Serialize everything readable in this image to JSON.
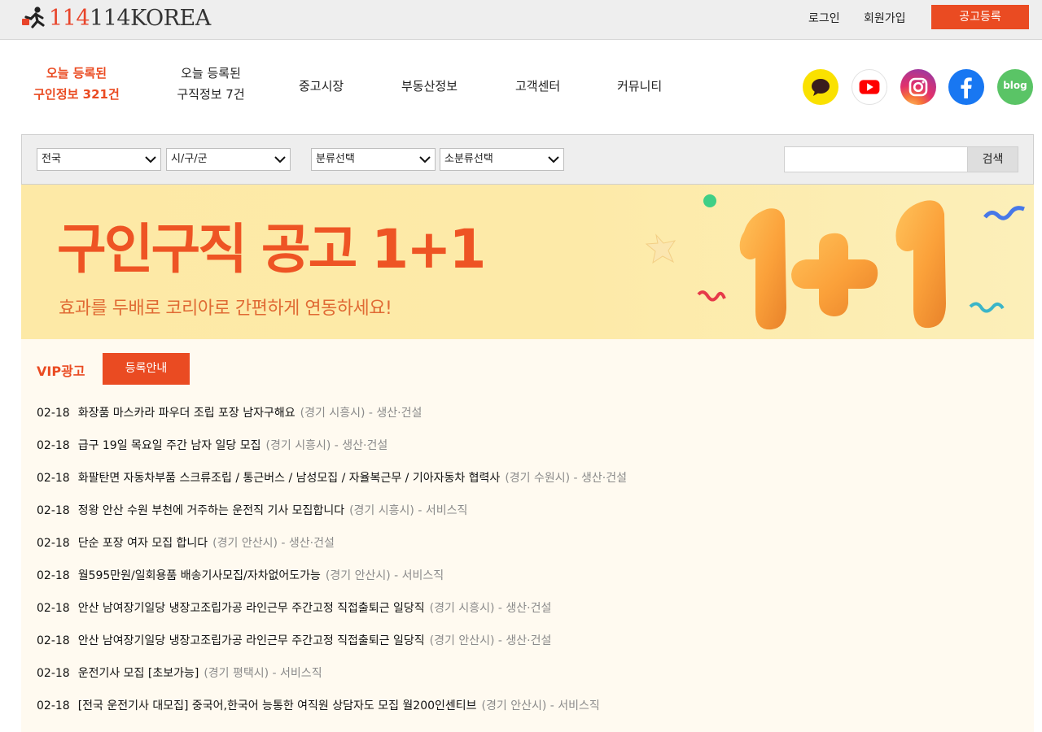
{
  "header": {
    "logo_prefix": "114",
    "logo_suffix": "114KOREA",
    "login": "로그인",
    "signup": "회원가입",
    "post_ad": "공고등록"
  },
  "nav": {
    "hiring_line1": "오늘 등록된",
    "hiring_line2": "구인정보 321건",
    "seeking_line1": "오늘 등록된",
    "seeking_line2": "구직정보 7건",
    "items": [
      "중고시장",
      "부동산정보",
      "고객센터",
      "커뮤니티"
    ]
  },
  "social": {
    "blog_label": "blog",
    "colors": {
      "kakao": "#fae100",
      "youtube": "#ff0000",
      "instagram": "#c13584",
      "facebook": "#1877f2",
      "blog": "#5ac466"
    }
  },
  "search": {
    "region": "전국",
    "district": "시/구/군",
    "category": "분류선택",
    "subcategory": "소분류선택",
    "query": "",
    "button": "검색"
  },
  "banner": {
    "title": "구인구직 공고 1+1",
    "subtitle": "효과를 두배로 코리아로 간편하게 연동하세요!"
  },
  "vip": {
    "label": "VIP광고",
    "button": "등록안내"
  },
  "jobs": [
    {
      "date": "02-18",
      "title": "화장품 마스카라 파우더 조립 포장 남자구해요",
      "location": "(경기 시흥시)",
      "category": "- 생산·건설"
    },
    {
      "date": "02-18",
      "title": "급구 19일 목요일 주간 남자 일당 모집",
      "location": "(경기 시흥시)",
      "category": "- 생산·건설"
    },
    {
      "date": "02-18",
      "title": "화팔탄면 자동차부품 스크류조립 / 통근버스 / 남성모집 / 자율복근무 / 기아자동차 협력사",
      "location": "(경기 수원시)",
      "category": "- 생산·건설"
    },
    {
      "date": "02-18",
      "title": "정왕 안산 수원 부천에 거주하는 운전직 기사 모집합니다",
      "location": "(경기 시흥시)",
      "category": "- 서비스직"
    },
    {
      "date": "02-18",
      "title": "단순 포장 여자 모집 합니다",
      "location": "(경기 안산시)",
      "category": "- 생산·건설"
    },
    {
      "date": "02-18",
      "title": "월595만원/일회용품 배송기사모집/자차없어도가능",
      "location": "(경기 안산시)",
      "category": "- 서비스직"
    },
    {
      "date": "02-18",
      "title": "안산 남여장기일당 냉장고조립가공 라인근무 주간고정 직접출퇴근 일당직",
      "location": "(경기 시흥시)",
      "category": "- 생산·건설"
    },
    {
      "date": "02-18",
      "title": "안산 남여장기일당 냉장고조립가공 라인근무 주간고정 직접출퇴근 일당직",
      "location": "(경기 안산시)",
      "category": "- 생산·건설"
    },
    {
      "date": "02-18",
      "title": "운전기사 모집 [초보가능]",
      "location": "(경기 평택시)",
      "category": "- 서비스직"
    },
    {
      "date": "02-18",
      "title": "[전국 운전기사 대모집] 중국어,한국어 능통한 여직원 상담자도 모집 월200인센티브",
      "location": "(경기 안산시)",
      "category": "- 서비스직"
    }
  ]
}
